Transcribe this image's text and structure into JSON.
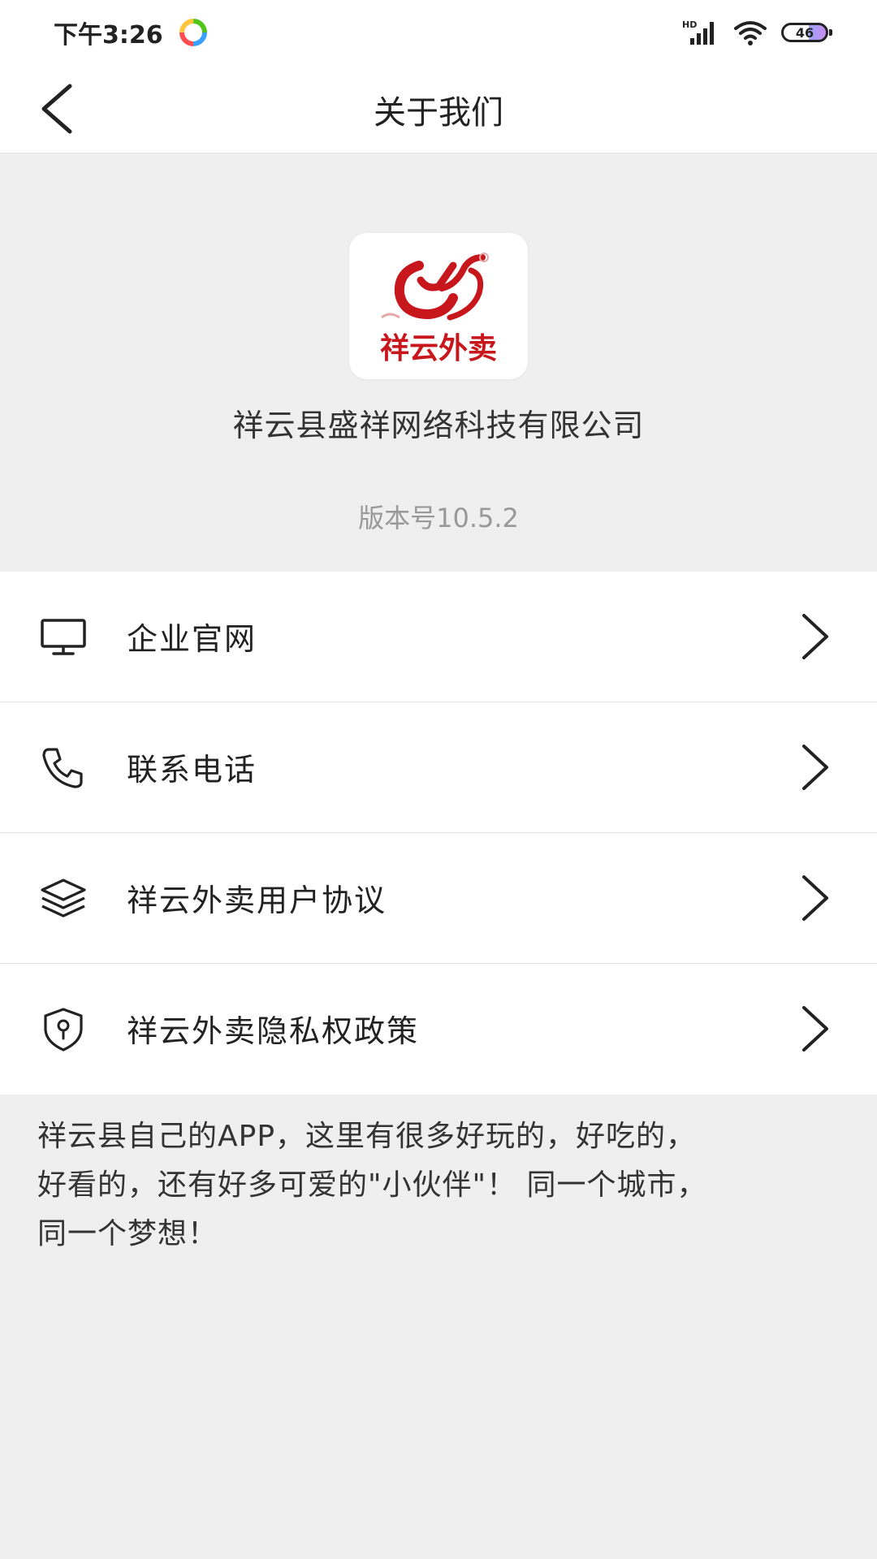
{
  "status_bar": {
    "time": "下午3:26",
    "network_label": "HD",
    "battery": "46"
  },
  "header": {
    "title": "关于我们",
    "back_icon": "chevron-left-icon"
  },
  "info": {
    "app_logo_text": "祥云外卖",
    "company": "祥云县盛祥网络科技有限公司",
    "version": "版本号10.5.2"
  },
  "menu": {
    "items": [
      {
        "label": "企业官网",
        "icon": "monitor-icon"
      },
      {
        "label": "联系电话",
        "icon": "phone-icon"
      },
      {
        "label": "祥云外卖用户协议",
        "icon": "layers-icon"
      },
      {
        "label": "祥云外卖隐私权政策",
        "icon": "shield-lock-icon"
      }
    ]
  },
  "description": {
    "line1": "祥云县自己的APP，这里有很多好玩的，好吃的，",
    "line2": "好看的，还有好多可爱的\"小伙伴\"！ 同一个城市，",
    "line3": "同一个梦想！"
  },
  "colors": {
    "page_bg": "#efefef",
    "card_bg": "#ffffff",
    "logo_red": "#c8161d",
    "muted_text": "#999999"
  }
}
